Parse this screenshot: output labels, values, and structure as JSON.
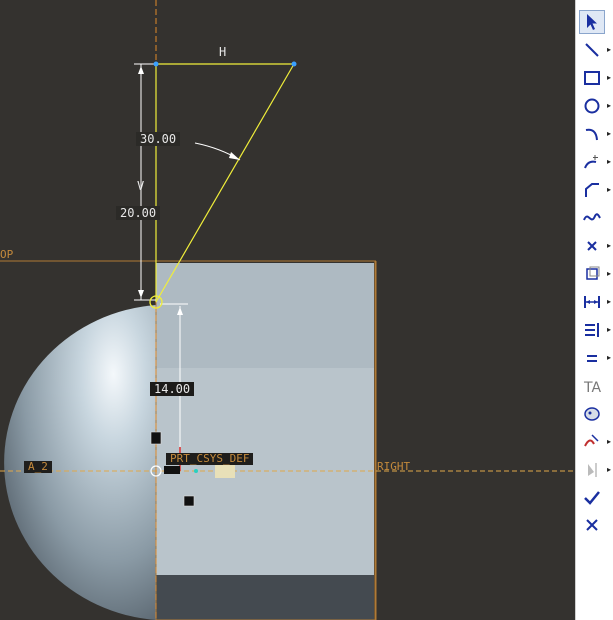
{
  "canvas": {
    "dims": {
      "h_label": "H",
      "angle_value": "30.00",
      "v_label": "V",
      "vertical_value": "20.00",
      "height_value": "14.00"
    },
    "refs": {
      "top_label": "OP",
      "right_label": "RIGHT",
      "axis_label": "A_2",
      "csys_label": "PRT_CSYS_DEF"
    }
  },
  "toolbar": {
    "tools": [
      {
        "name": "select-icon",
        "has_menu": false
      },
      {
        "name": "line-icon",
        "has_menu": true
      },
      {
        "name": "rectangle-icon",
        "has_menu": true
      },
      {
        "name": "circle-icon",
        "has_menu": true
      },
      {
        "name": "arc-icon",
        "has_menu": true
      },
      {
        "name": "fillet-icon",
        "has_menu": true
      },
      {
        "name": "chamfer-icon",
        "has_menu": true
      },
      {
        "name": "spline-icon",
        "has_menu": false
      },
      {
        "name": "point-icon",
        "has_menu": true
      },
      {
        "name": "offset-icon",
        "has_menu": true
      },
      {
        "name": "dimension-icon",
        "has_menu": true
      },
      {
        "name": "modify-icon",
        "has_menu": true
      },
      {
        "name": "constraint-icon",
        "has_menu": true
      },
      {
        "name": "text-icon",
        "has_menu": false
      },
      {
        "name": "palette-icon",
        "has_menu": false
      },
      {
        "name": "trim-icon",
        "has_menu": true
      },
      {
        "name": "mirror-icon",
        "has_menu": true
      },
      {
        "name": "accept-icon",
        "has_menu": false
      },
      {
        "name": "cancel-icon",
        "has_menu": false
      }
    ]
  },
  "colors": {
    "background": "#34322f",
    "sketch_line": "#f0ee3a",
    "reference": "#c48a3c",
    "axis_dash": "#e0a84a",
    "accept": "#1a2fa0"
  }
}
